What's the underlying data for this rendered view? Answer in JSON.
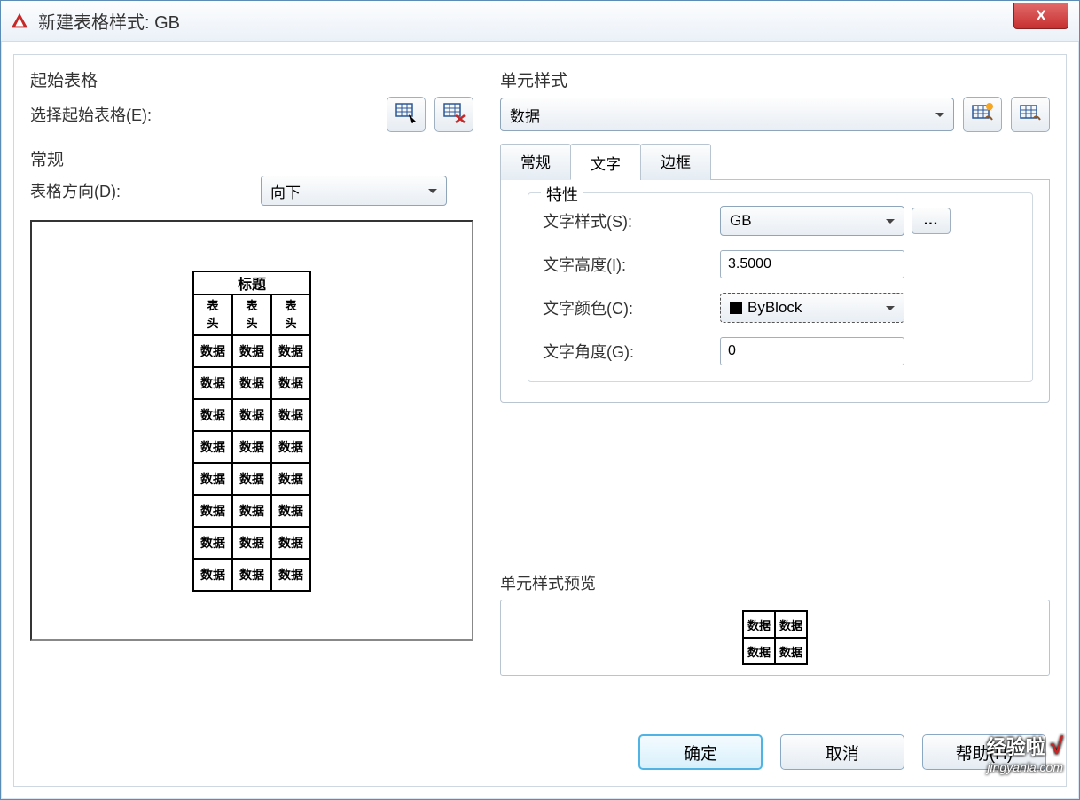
{
  "window": {
    "title": "新建表格样式: GB"
  },
  "left": {
    "start_table_group": "起始表格",
    "select_start_label": "选择起始表格(E):",
    "general_group": "常规",
    "direction_label": "表格方向(D):",
    "direction_value": "向下"
  },
  "preview": {
    "title_row": "标题",
    "header_cell": "表\n头",
    "data_cell": "数据"
  },
  "right": {
    "cell_style_group": "单元样式",
    "cell_style_value": "数据",
    "tabs": {
      "general": "常规",
      "text": "文字",
      "border": "边框"
    },
    "props_legend": "特性",
    "text_style_label": "文字样式(S):",
    "text_style_value": "GB",
    "text_height_label": "文字高度(I):",
    "text_height_value": "3.5000",
    "text_color_label": "文字颜色(C):",
    "text_color_value": "ByBlock",
    "text_angle_label": "文字角度(G):",
    "text_angle_value": "0",
    "style_preview_label": "单元样式预览"
  },
  "buttons": {
    "ok": "确定",
    "cancel": "取消",
    "help": "帮助(H)"
  },
  "watermark": {
    "line1": "经验啦",
    "line2": "jingyanla.com"
  },
  "icons": {
    "ellipsis": "..."
  }
}
